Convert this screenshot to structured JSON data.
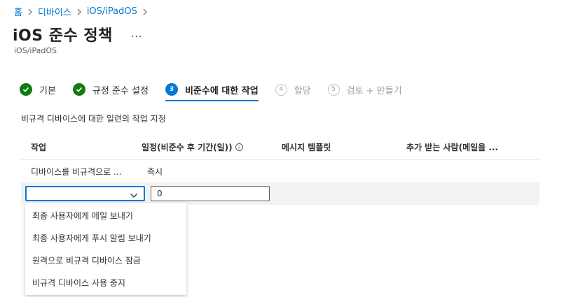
{
  "breadcrumb": {
    "items": [
      "홈",
      "디바이스",
      "iOS/iPadOS"
    ]
  },
  "header": {
    "title": "iOS 준수 정책",
    "more": "...",
    "subtitle": "iOS/iPadOS"
  },
  "wizard": {
    "steps": [
      {
        "label": "기본",
        "status": "done"
      },
      {
        "label": "규정 준수 설정",
        "status": "done"
      },
      {
        "label": "비준수에 대한 작업",
        "status": "current",
        "number": "3"
      },
      {
        "label": "할당",
        "status": "future",
        "number": "4"
      },
      {
        "label": "검토 + 만들기",
        "status": "future",
        "number": "5"
      }
    ]
  },
  "main": {
    "description": "비규격 디바이스에 대한 일련의 작업 지정",
    "columns": {
      "action": "작업",
      "schedule": "일정(비준수 후 기간(일))",
      "message": "메시지 템플릿",
      "recipients": "추가 받는 사람(메일을 ..."
    },
    "rows": [
      {
        "action": "디바이스를 비규격으로 ...",
        "schedule": "즉시"
      }
    ],
    "edit_row": {
      "action_value": "",
      "days_value": "0"
    }
  },
  "dropdown": {
    "options": [
      "최종 사용자에게 메일 보내기",
      "최종 사용자에게 푸시 알림 보내기",
      "원격으로 비규격 디바이스 잠금",
      "비규격 디바이스 사용 중지"
    ]
  },
  "colors": {
    "accent": "#0078d4",
    "success": "#107c10",
    "text": "#323130",
    "muted": "#a19f9d"
  }
}
